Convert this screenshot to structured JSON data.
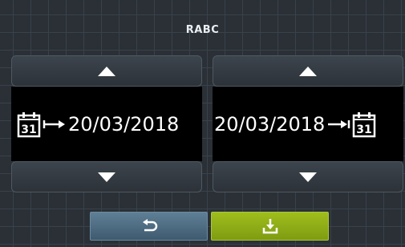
{
  "title": "RABC",
  "start": {
    "date": "20/03/2018",
    "calendar_day": "31",
    "up_icon": "triangle-up-icon",
    "down_icon": "triangle-down-icon"
  },
  "end": {
    "date": "20/03/2018",
    "calendar_day": "31",
    "up_icon": "triangle-up-icon",
    "down_icon": "triangle-down-icon"
  },
  "buttons": {
    "back_icon": "undo-icon",
    "save_icon": "download-icon"
  },
  "colors": {
    "background": "#2b3137",
    "date_field": "#000000",
    "back_button": "#4f6f86",
    "save_button": "#8fae17"
  }
}
